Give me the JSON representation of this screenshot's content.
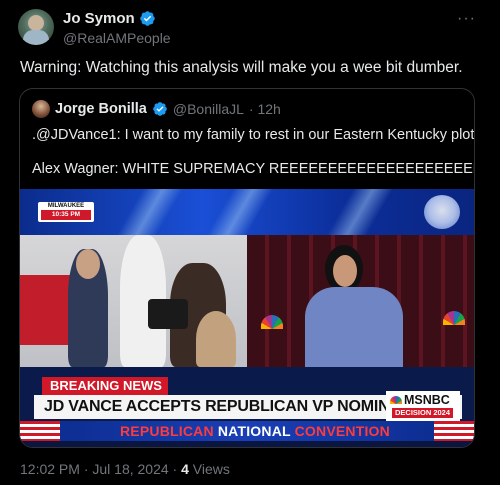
{
  "post": {
    "author_name": "Jo Symon",
    "author_handle": "@RealAMPeople",
    "more_label": "···",
    "text": "Warning: Watching this analysis will make you a wee bit dumber.",
    "timestamp": "12:02 PM · Jul 18, 2024 · ",
    "views_count": "4",
    "views_label": " Views"
  },
  "quote": {
    "author_name": "Jorge Bonilla",
    "author_handle": "@BonillaJL",
    "age": "· 12h",
    "line1": ".@JDVance1: I want to my family to rest in our Eastern Kentucky plot",
    "line2": "Alex Wagner: WHITE SUPREMACY REEEEEEEEEEEEEEEEEEEEEEEE"
  },
  "video": {
    "location": "MILWAUKEE",
    "time": "10:35 PM",
    "breaking": "BREAKING NEWS",
    "headline": "JD VANCE ACCEPTS REPUBLICAN VP NOMINATION",
    "network": "MSNBC",
    "decision": "DECISION 2024",
    "convention_word1": "REPUBLICAN",
    "convention_word2": "NATIONAL",
    "convention_word3": "CONVENTION"
  },
  "colors": {
    "verified": "#1d9bf0",
    "background": "#000000",
    "muted": "#71767b",
    "breaking_red": "#d01828"
  },
  "icons": [
    "verified-badge-icon",
    "more-options-icon",
    "peacock-icon"
  ]
}
